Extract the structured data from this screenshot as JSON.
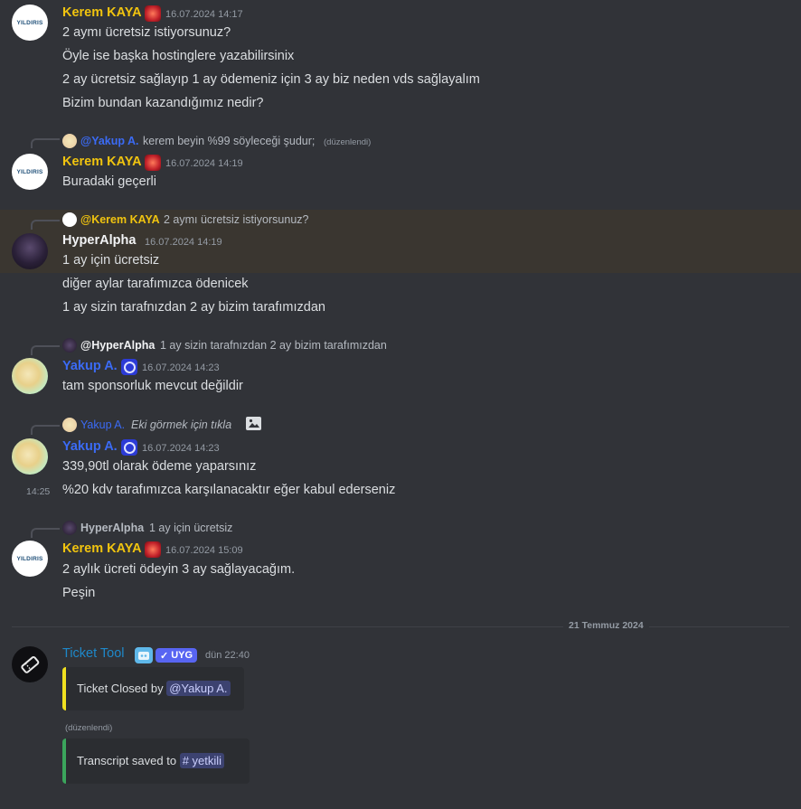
{
  "users": {
    "kerem": {
      "name": "Kerem KAYA",
      "color": "#f1c40f",
      "avatar_text": "YILDIRIS"
    },
    "hyper": {
      "name": "HyperAlpha",
      "color": "#f2f3f5"
    },
    "yakup": {
      "name": "Yakup A.",
      "color": "#3b6bf5"
    },
    "ticket": {
      "name": "Ticket Tool",
      "color": "#1e88c9",
      "app_tag": "UYG"
    }
  },
  "groups": [
    {
      "author": "Kerem KAYA",
      "time": "16.07.2024 14:17",
      "lines": [
        "2 aymı ücretsiz istiyorsunuz?",
        "Öyle ise başka hostinglere yazabilirsinix",
        "2 ay ücretsiz sağlayıp 1 ay ödemeniz için 3 ay biz neden vds sağlayalım",
        "Bizim bundan kazandığımız nedir?"
      ]
    },
    {
      "reply": {
        "name": "@Yakup A.",
        "text": "kerem beyin %99 söyleceği şudur;",
        "edited": "(düzenlendi)"
      },
      "author": "Kerem KAYA",
      "time": "16.07.2024 14:19",
      "lines": [
        "Buradaki geçerli"
      ]
    },
    {
      "reply": {
        "name": "@Kerem KAYA",
        "text": "2 aymı ücretsiz istiyorsunuz?"
      },
      "author": "HyperAlpha",
      "time": "16.07.2024 14:19",
      "lines": [
        "1 ay için ücretsiz",
        "diğer aylar tarafımızca ödenicek",
        "1 ay sizin tarafnızdan 2 ay bizim tarafımızdan"
      ]
    },
    {
      "reply": {
        "name": "@HyperAlpha",
        "text": "1 ay sizin tarafnızdan 2 ay bizim tarafımızdan"
      },
      "author": "Yakup A.",
      "time": "16.07.2024 14:23",
      "lines": [
        "tam sponsorluk mevcut değildir"
      ]
    },
    {
      "reply": {
        "name": "Yakup A.",
        "text": "Eki görmek için tıkla"
      },
      "author": "Yakup A.",
      "time": "16.07.2024 14:23",
      "lines": [
        "339,90tl olarak ödeme yaparsınız",
        "%20 kdv tarafımızca karşılanacaktır eğer kabul ederseniz"
      ],
      "hover_time": "14:25"
    },
    {
      "reply": {
        "name": "HyperAlpha",
        "text": "1 ay için ücretsiz"
      },
      "author": "Kerem KAYA",
      "time": "16.07.2024 15:09",
      "lines": [
        "2 aylık ücreti ödeyin 3 ay sağlayacağım.",
        "Peşin"
      ]
    }
  ],
  "date_divider": "21 Temmuz 2024",
  "ticket": {
    "author": "Ticket Tool",
    "app_tag": "UYG",
    "time": "dün 22:40",
    "embed1": {
      "prefix": "Ticket Closed by ",
      "mention": "@Yakup A.",
      "border": "#f0e020"
    },
    "edited": "(düzenlendi)",
    "embed2": {
      "prefix": "Transcript saved to ",
      "mention": "# yetkili",
      "border": "#3ba55c"
    }
  }
}
